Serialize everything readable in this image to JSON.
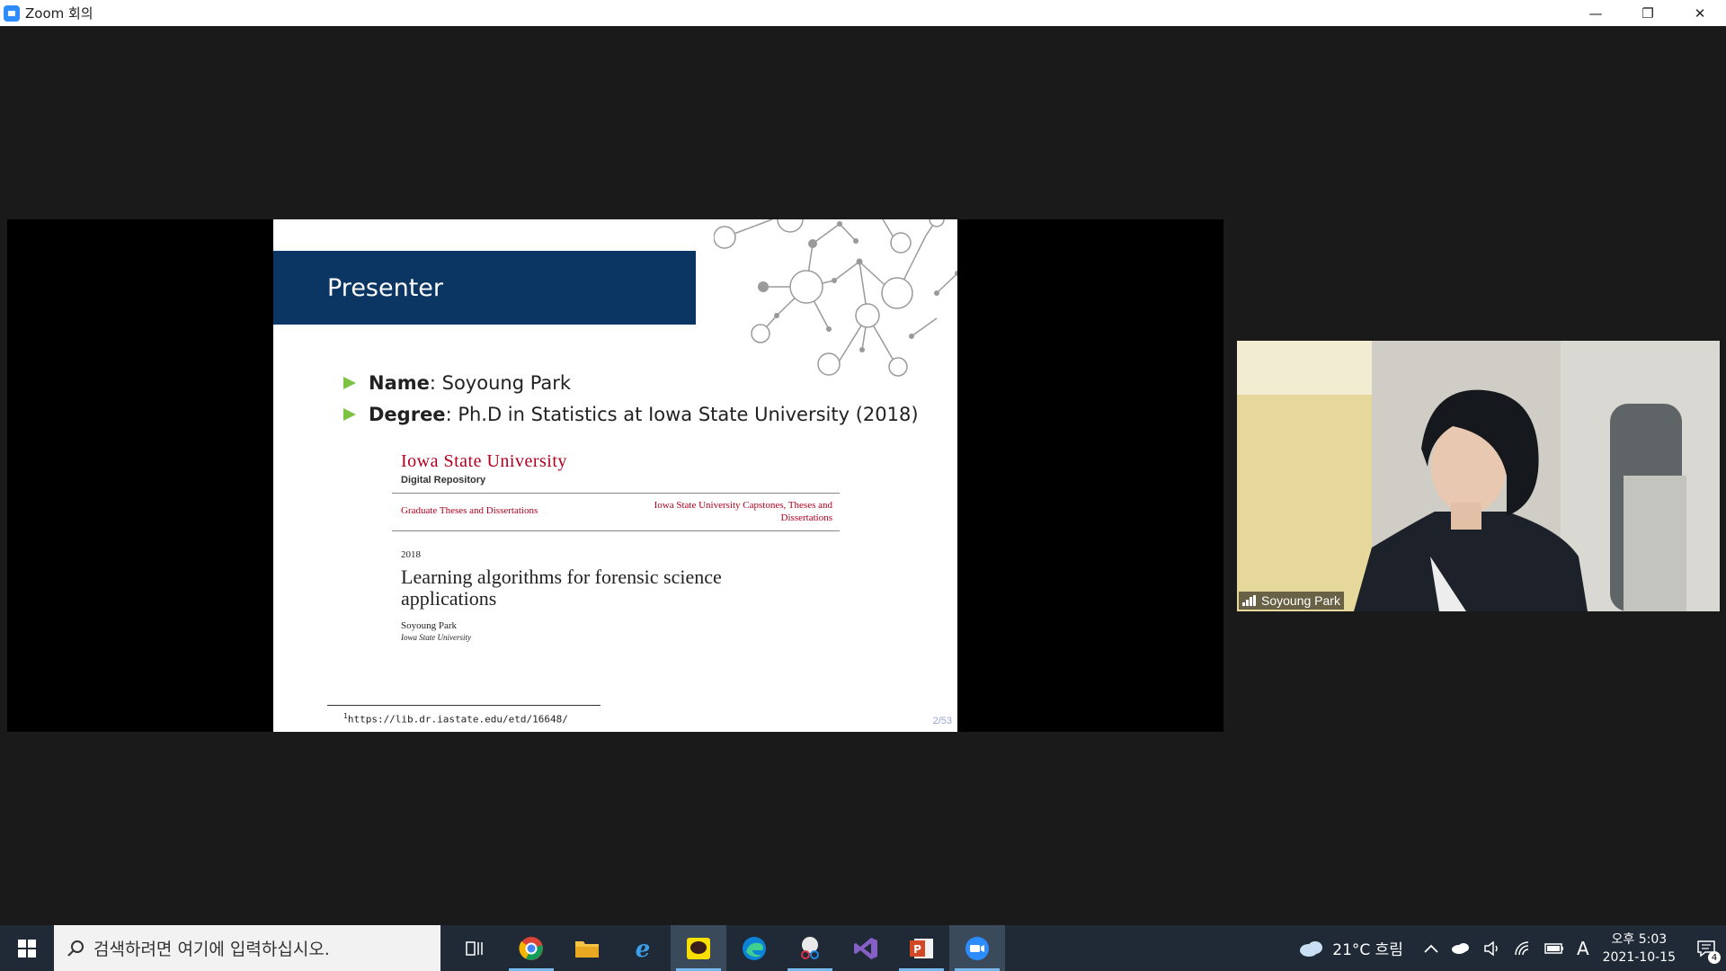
{
  "window": {
    "title": "Zoom 회의",
    "minimize": "—",
    "restore": "❐",
    "close": "✕"
  },
  "slide": {
    "heading": "Presenter",
    "bullets": [
      {
        "label": "Name",
        "value": ": Soyoung Park"
      },
      {
        "label": "Degree",
        "value": ": Ph.D in Statistics at Iowa State University (2018)"
      }
    ],
    "paper": {
      "university": "Iowa State University",
      "repository": "Digital Repository",
      "collection_left": "Graduate Theses and Dissertations",
      "collection_right": "Iowa State University Capstones, Theses and Dissertations",
      "year": "2018",
      "title": "Learning algorithms for forensic science applications",
      "author": "Soyoung Park",
      "affiliation": "Iowa State University"
    },
    "footnote_mark": "1",
    "footnote": "https://lib.dr.iastate.edu/etd/16648/",
    "page": "2/53",
    "accent": "#0b3663",
    "bullet_color": "#7cc243"
  },
  "video": {
    "participant": "Soyoung Park"
  },
  "taskbar": {
    "search_placeholder": "검색하려면 여기에 입력하십시오.",
    "weather": "21°C 흐림",
    "clock_ampm_time": "오후 5:03",
    "clock_date": "2021-10-15",
    "ime": "A",
    "notification_count": "4"
  }
}
